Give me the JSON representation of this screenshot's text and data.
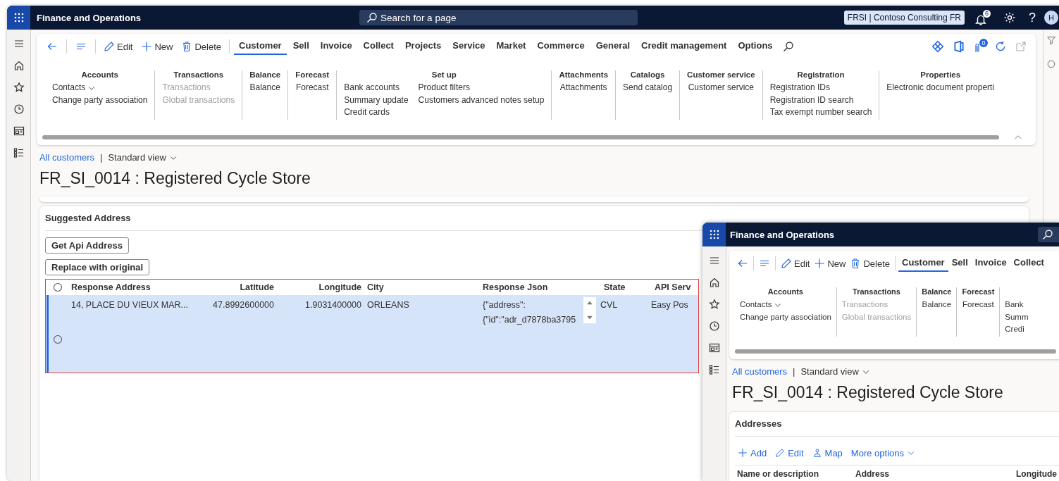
{
  "window": {
    "app_title": "Finance and Operations",
    "search_placeholder": "Search for a page",
    "company": "FRSI | Contoso Consulting FR",
    "notification_count": "6",
    "help": "?",
    "avatar": "H"
  },
  "action_pane": {
    "actions": [
      {
        "kind": "edit",
        "label": "Edit"
      },
      {
        "kind": "new",
        "label": "New"
      },
      {
        "kind": "delete",
        "label": "Delete"
      }
    ],
    "tabs": [
      {
        "label": "Customer",
        "selected": true
      },
      {
        "label": "Sell",
        "selected": false
      },
      {
        "label": "Invoice",
        "selected": false
      },
      {
        "label": "Collect",
        "selected": false
      },
      {
        "label": "Projects",
        "selected": false
      },
      {
        "label": "Service",
        "selected": false
      },
      {
        "label": "Market",
        "selected": false
      },
      {
        "label": "Commerce",
        "selected": false
      },
      {
        "label": "General",
        "selected": false
      },
      {
        "label": "Credit management",
        "selected": false
      },
      {
        "label": "Options",
        "selected": false
      }
    ],
    "attachment_count": "0",
    "groups": [
      {
        "title": "Accounts",
        "columns": [
          [
            {
              "label": "Contacts",
              "kind": "menu",
              "disabled": false
            },
            {
              "label": "Change party association",
              "kind": "link",
              "disabled": false
            }
          ]
        ]
      },
      {
        "title": "Transactions",
        "columns": [
          [
            {
              "label": "Transactions",
              "kind": "link",
              "disabled": true
            },
            {
              "label": "Global transactions",
              "kind": "link",
              "disabled": true
            }
          ]
        ]
      },
      {
        "title": "Balance",
        "columns": [
          [
            {
              "label": "Balance",
              "kind": "link",
              "disabled": false
            }
          ]
        ]
      },
      {
        "title": "Forecast",
        "columns": [
          [
            {
              "label": "Forecast",
              "kind": "link",
              "disabled": false
            }
          ]
        ]
      },
      {
        "title": "Set up",
        "columns": [
          [
            {
              "label": "Bank accounts",
              "kind": "link",
              "disabled": false
            },
            {
              "label": "Summary update",
              "kind": "link",
              "disabled": false
            },
            {
              "label": "Credit cards",
              "kind": "link",
              "disabled": false
            }
          ],
          [
            {
              "label": "Product filters",
              "kind": "link",
              "disabled": false
            },
            {
              "label": "Customers advanced notes setup",
              "kind": "link",
              "disabled": false
            }
          ]
        ]
      },
      {
        "title": "Attachments",
        "columns": [
          [
            {
              "label": "Attachments",
              "kind": "link",
              "disabled": false
            }
          ]
        ]
      },
      {
        "title": "Catalogs",
        "columns": [
          [
            {
              "label": "Send catalog",
              "kind": "link",
              "disabled": false
            }
          ]
        ]
      },
      {
        "title": "Customer service",
        "columns": [
          [
            {
              "label": "Customer service",
              "kind": "link",
              "disabled": false
            }
          ]
        ]
      },
      {
        "title": "Registration",
        "columns": [
          [
            {
              "label": "Registration IDs",
              "kind": "link",
              "disabled": false
            },
            {
              "label": "Registration ID search",
              "kind": "link",
              "disabled": false
            },
            {
              "label": "Tax exempt number search",
              "kind": "link",
              "disabled": false
            }
          ]
        ]
      },
      {
        "title": "Properties",
        "columns": [
          [
            {
              "label": "Electronic document properti",
              "kind": "link",
              "disabled": false
            }
          ]
        ]
      }
    ]
  },
  "breadcrumb": {
    "link": "All customers",
    "separator": "|",
    "view": "Standard view"
  },
  "page_title": "FR_SI_0014 : Registered Cycle Store",
  "suggested_address": {
    "title": "Suggested Address",
    "buttons": [
      "Get Api Address",
      "Replace with original"
    ],
    "select_all_checked": false,
    "columns": [
      "Response Address",
      "Latitude",
      "Longitude",
      "City",
      "Response Json",
      "State",
      "API Serv"
    ],
    "rows": [
      {
        "selected": true,
        "checked": false,
        "cells": [
          "14, PLACE DU VIEUX MAR...",
          "47.8992600000",
          "1.9031400000",
          "ORLEANS",
          "{\"address\": {\"id\":\"adr_d7878ba3795",
          "CVL",
          "Easy Pos"
        ]
      }
    ]
  },
  "second_window": {
    "app_title": "Finance and Operations",
    "action_pane": {
      "actions": [
        {
          "kind": "edit",
          "label": "Edit"
        },
        {
          "kind": "new",
          "label": "New"
        },
        {
          "kind": "delete",
          "label": "Delete"
        }
      ],
      "tabs": [
        {
          "label": "Customer",
          "selected": true
        },
        {
          "label": "Sell",
          "selected": false
        },
        {
          "label": "Invoice",
          "selected": false
        },
        {
          "label": "Collect",
          "selected": false
        }
      ],
      "groups": [
        {
          "title": "Accounts",
          "columns": [
            [
              {
                "label": "Contacts",
                "kind": "menu",
                "disabled": false
              },
              {
                "label": "Change party association",
                "kind": "link",
                "disabled": false
              }
            ]
          ]
        },
        {
          "title": "Transactions",
          "columns": [
            [
              {
                "label": "Transactions",
                "kind": "link",
                "disabled": true
              },
              {
                "label": "Global transactions",
                "kind": "link",
                "disabled": true
              }
            ]
          ]
        },
        {
          "title": "Balance",
          "columns": [
            [
              {
                "label": "Balance",
                "kind": "link",
                "disabled": false
              }
            ]
          ]
        },
        {
          "title": "Forecast",
          "columns": [
            [
              {
                "label": "Forecast",
                "kind": "link",
                "disabled": false
              }
            ]
          ]
        },
        {
          "columns": [
            [
              {
                "label": "Bank",
                "kind": "link",
                "disabled": false
              },
              {
                "label": "Summ",
                "kind": "link",
                "disabled": false
              },
              {
                "label": "Credi",
                "kind": "link",
                "disabled": false
              }
            ]
          ]
        }
      ]
    },
    "breadcrumb": {
      "link": "All customers",
      "separator": "|",
      "view": "Standard view"
    },
    "page_title": "FR_SI_0014 : Registered Cycle Store",
    "addresses": {
      "title": "Addresses",
      "actions": [
        {
          "kind": "add",
          "label": "Add"
        },
        {
          "kind": "edit",
          "label": "Edit"
        },
        {
          "kind": "map",
          "label": "Map"
        },
        {
          "kind": "menu",
          "label": "More options"
        }
      ],
      "columns": [
        "Name or description",
        "Address",
        "Longitude"
      ]
    }
  }
}
